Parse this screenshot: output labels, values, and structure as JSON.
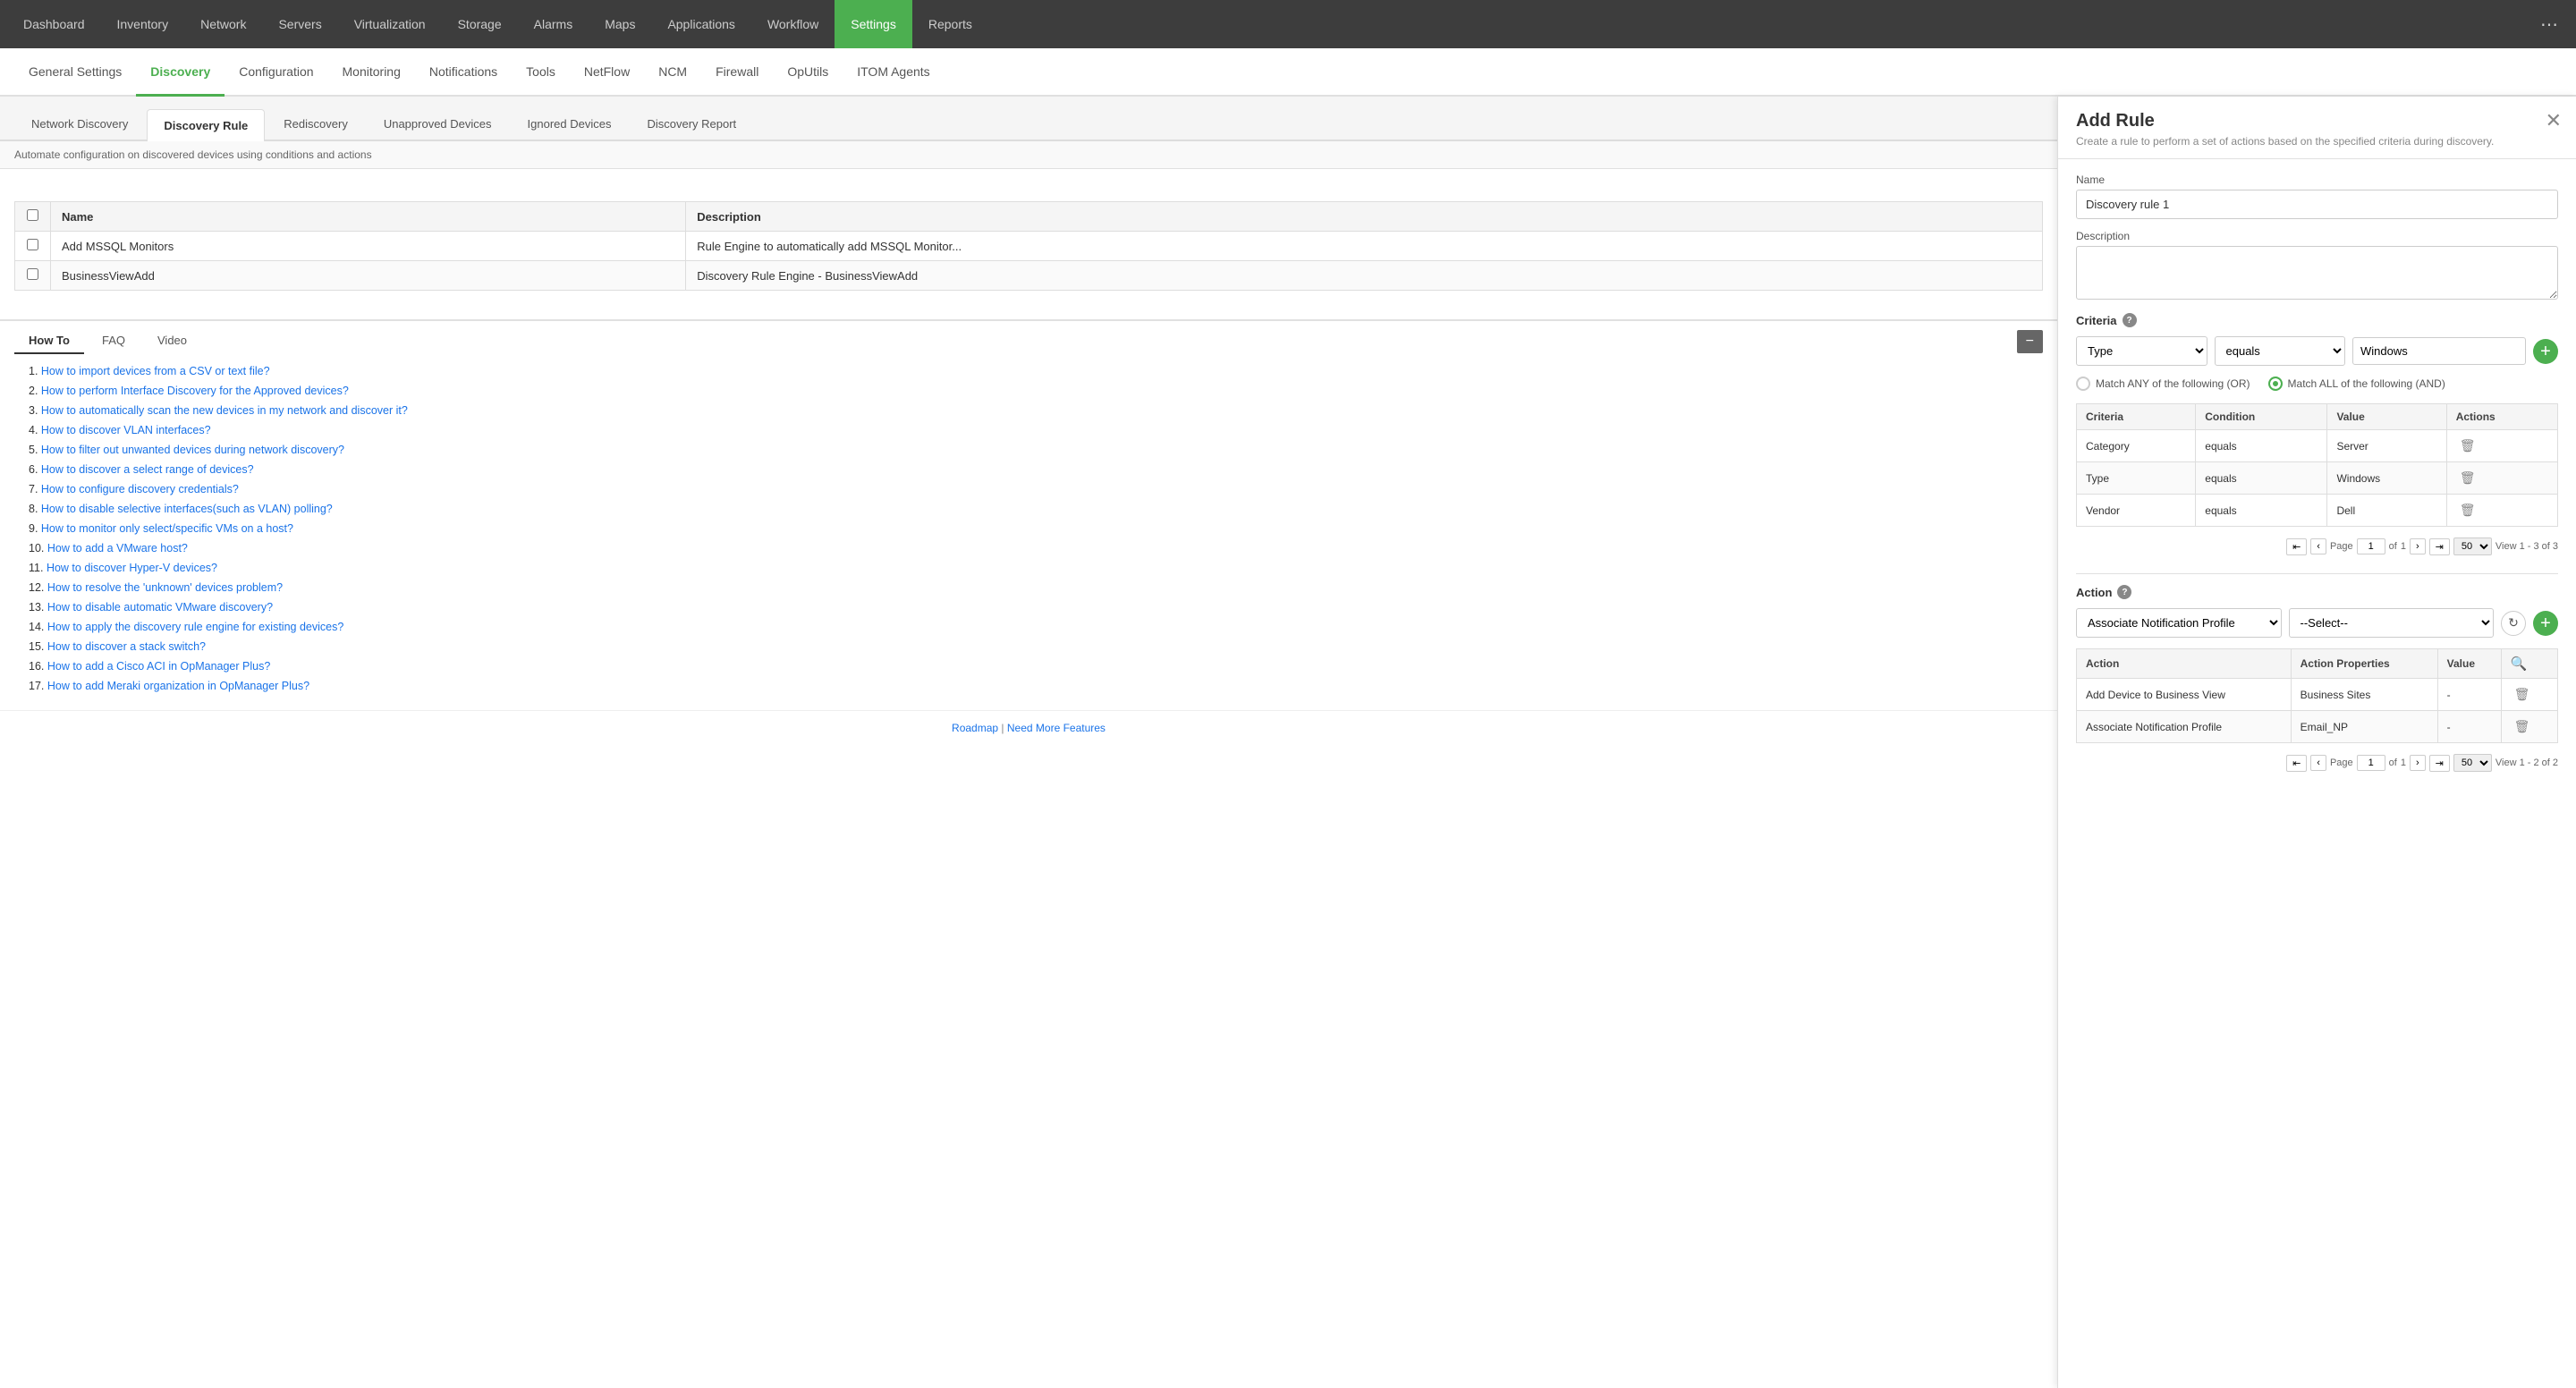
{
  "topNav": {
    "items": [
      {
        "label": "Dashboard",
        "active": false
      },
      {
        "label": "Inventory",
        "active": false
      },
      {
        "label": "Network",
        "active": false
      },
      {
        "label": "Servers",
        "active": false
      },
      {
        "label": "Virtualization",
        "active": false
      },
      {
        "label": "Storage",
        "active": false
      },
      {
        "label": "Alarms",
        "active": false
      },
      {
        "label": "Maps",
        "active": false
      },
      {
        "label": "Applications",
        "active": false
      },
      {
        "label": "Workflow",
        "active": false
      },
      {
        "label": "Settings",
        "active": true
      },
      {
        "label": "Reports",
        "active": false
      }
    ]
  },
  "subNav": {
    "items": [
      {
        "label": "General Settings",
        "active": false
      },
      {
        "label": "Discovery",
        "active": true
      },
      {
        "label": "Configuration",
        "active": false
      },
      {
        "label": "Monitoring",
        "active": false
      },
      {
        "label": "Notifications",
        "active": false
      },
      {
        "label": "Tools",
        "active": false
      },
      {
        "label": "NetFlow",
        "active": false
      },
      {
        "label": "NCM",
        "active": false
      },
      {
        "label": "Firewall",
        "active": false
      },
      {
        "label": "OpUtils",
        "active": false
      },
      {
        "label": "ITOM Agents",
        "active": false
      }
    ]
  },
  "tabs": [
    {
      "label": "Network Discovery",
      "active": false
    },
    {
      "label": "Discovery Rule",
      "active": true
    },
    {
      "label": "Rediscovery",
      "active": false
    },
    {
      "label": "Unapproved Devices",
      "active": false
    },
    {
      "label": "Ignored Devices",
      "active": false
    },
    {
      "label": "Discovery Report",
      "active": false
    }
  ],
  "tableDescription": "Automate configuration on discovered devices using conditions and actions",
  "tableHeaders": [
    "",
    "Name",
    "Description"
  ],
  "tableRows": [
    {
      "name": "Add MSSQL Monitors",
      "description": "Rule Engine to automatically add MSSQL Monitor..."
    },
    {
      "name": "BusinessViewAdd",
      "description": "Discovery Rule Engine - BusinessViewAdd"
    }
  ],
  "howTo": {
    "tabs": [
      {
        "label": "How To",
        "active": true
      },
      {
        "label": "FAQ",
        "active": false
      },
      {
        "label": "Video",
        "active": false
      }
    ],
    "items": [
      "How to import devices from a CSV or text file?",
      "How to perform Interface Discovery for the Approved devices?",
      "How to automatically scan the new devices in my network and discover it?",
      "How to discover VLAN interfaces?",
      "How to filter out unwanted devices during network discovery?",
      "How to discover a select range of devices?",
      "How to configure discovery credentials?",
      "How to disable selective interfaces(such as VLAN) polling?",
      "How to monitor only select/specific VMs on a host?",
      "How to add a VMware host?",
      "How to discover Hyper-V devices?",
      "How to resolve the 'unknown' devices problem?",
      "How to disable automatic VMware discovery?",
      "How to apply the discovery rule engine for existing devices?",
      "How to discover a stack switch?",
      "How to add a Cisco ACI in OpManager Plus?",
      "How to add Meraki organization in OpManager Plus?"
    ]
  },
  "footer": {
    "roadmap": "Roadmap",
    "separator": "|",
    "moreFeatures": "Need More Features"
  },
  "addRule": {
    "title": "Add Rule",
    "subtitle": "Create a rule to perform a set of actions based on the specified criteria during discovery.",
    "nameLabel": "Name",
    "nameValue": "Discovery rule 1",
    "descriptionLabel": "Description",
    "descriptionValue": "",
    "criteriaLabel": "Criteria",
    "criteriaType": "Type",
    "criteriaCondition": "equals",
    "criteriaValue": "Windows",
    "matchAny": "Match ANY of the following (OR)",
    "matchAll": "Match ALL of the following (AND)",
    "matchAllActive": true,
    "criteriaTableHeaders": [
      "Criteria",
      "Condition",
      "Value",
      "Actions"
    ],
    "criteriaRows": [
      {
        "criteria": "Category",
        "condition": "equals",
        "value": "Server"
      },
      {
        "criteria": "Type",
        "condition": "equals",
        "value": "Windows"
      },
      {
        "criteria": "Vendor",
        "condition": "equals",
        "value": "Dell"
      }
    ],
    "criteriaPage": "1",
    "criteriaOf": "1",
    "criteriaPerPage": "50",
    "criteriaView": "View 1 - 3 of 3",
    "actionLabel": "Action",
    "actionValue": "Associate Notification Profile",
    "actionSelectValue": "--Select--",
    "actionTableHeaders": [
      "Action",
      "Action Properties",
      "Value",
      ""
    ],
    "actionRows": [
      {
        "action": "Add Device to Business View",
        "actionProperties": "Business Sites",
        "value": "-"
      },
      {
        "action": "Associate Notification Profile",
        "actionProperties": "Email_NP",
        "value": "-"
      }
    ],
    "actionPage": "1",
    "actionOf": "1",
    "actionPerPage": "50",
    "actionView": "View 1 - 2 of 2"
  }
}
